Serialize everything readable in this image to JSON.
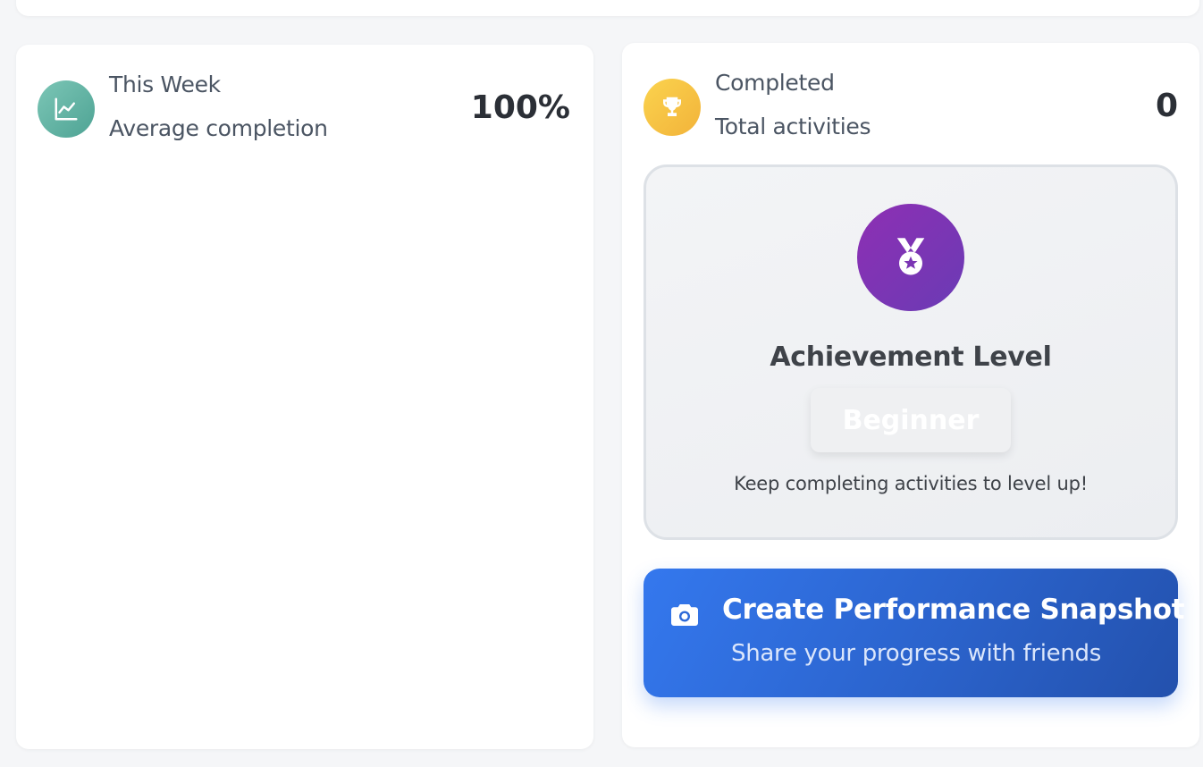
{
  "weekly_stat": {
    "title": "This Week",
    "subtitle": "Average completion",
    "value": "100%",
    "icon": "chart-line-icon"
  },
  "completed_stat": {
    "title": "Completed",
    "subtitle": "Total activities",
    "value": "0",
    "icon": "trophy-icon"
  },
  "achievement": {
    "title": "Achievement Level",
    "level": "Beginner",
    "hint": "Keep completing activities to level up!",
    "icon": "medal-icon"
  },
  "snapshot": {
    "title": "Create Performance Snapshot",
    "subtitle": "Share your progress with friends",
    "icon": "camera-icon"
  },
  "colors": {
    "accent_blue": "#3478ee",
    "teal": "#5bb0a1",
    "gold": "#f6c343",
    "purple": "#7b35b4"
  }
}
